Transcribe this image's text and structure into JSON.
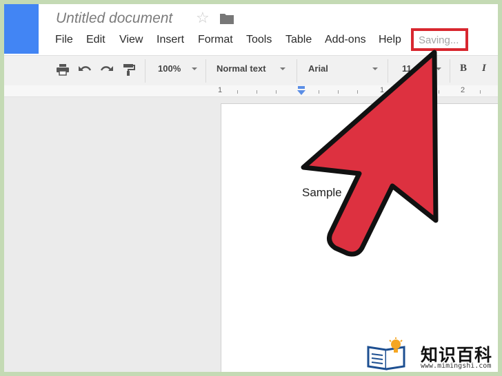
{
  "window": {
    "title": "Untitled document"
  },
  "menu": {
    "items": [
      {
        "label": "File"
      },
      {
        "label": "Edit"
      },
      {
        "label": "View"
      },
      {
        "label": "Insert"
      },
      {
        "label": "Format"
      },
      {
        "label": "Tools"
      },
      {
        "label": "Table"
      },
      {
        "label": "Add-ons"
      },
      {
        "label": "Help"
      }
    ],
    "status": "Saving..."
  },
  "toolbar": {
    "zoom": "100%",
    "style": "Normal text",
    "font": "Arial",
    "font_size": "11",
    "bold_label": "B",
    "italic_label": "I"
  },
  "ruler": {
    "labels": [
      "1",
      "1",
      "2"
    ]
  },
  "document": {
    "body_text": "Sample"
  },
  "watermark": {
    "name": "知识百科",
    "url": "www.mimingshi.com"
  },
  "colors": {
    "accent_blue": "#4285f4",
    "highlight_red": "#d8272f",
    "arrow_red": "#dd3140",
    "frame_green": "#c4dab4"
  },
  "icons": [
    "print-icon",
    "undo-icon",
    "redo-icon",
    "paint-format-icon",
    "star-icon",
    "folder-icon"
  ]
}
